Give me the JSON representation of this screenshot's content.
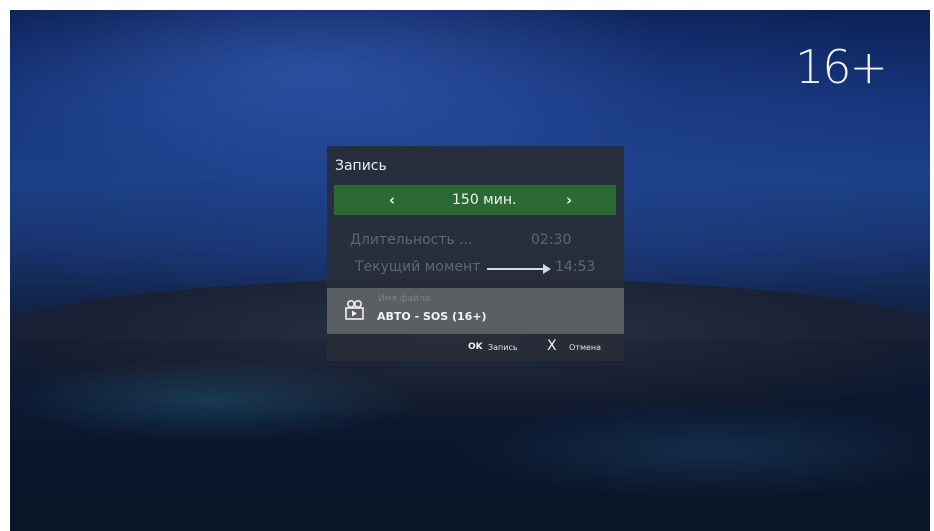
{
  "age_rating": "16+",
  "dialog": {
    "title": "Запись",
    "selector": {
      "left_arrow": "‹",
      "value": "150 мин.",
      "right_arrow": "›"
    },
    "duration": {
      "label": "Длительность ...",
      "value": "02:30"
    },
    "current_moment": {
      "label": "Текущий момент",
      "value": "14:53"
    },
    "file": {
      "icon": "video-file-icon",
      "label": "Имя файла",
      "name": "АВТО - SOS (16+)"
    },
    "footer": {
      "ok_key": "OK",
      "record_label": "Запись",
      "cancel_key": "X",
      "cancel_label": "Отмена"
    }
  },
  "colors": {
    "selector_bg": "#2c6a33",
    "dialog_bg": "#282d38",
    "file_panel_bg": "#5b5e63"
  }
}
